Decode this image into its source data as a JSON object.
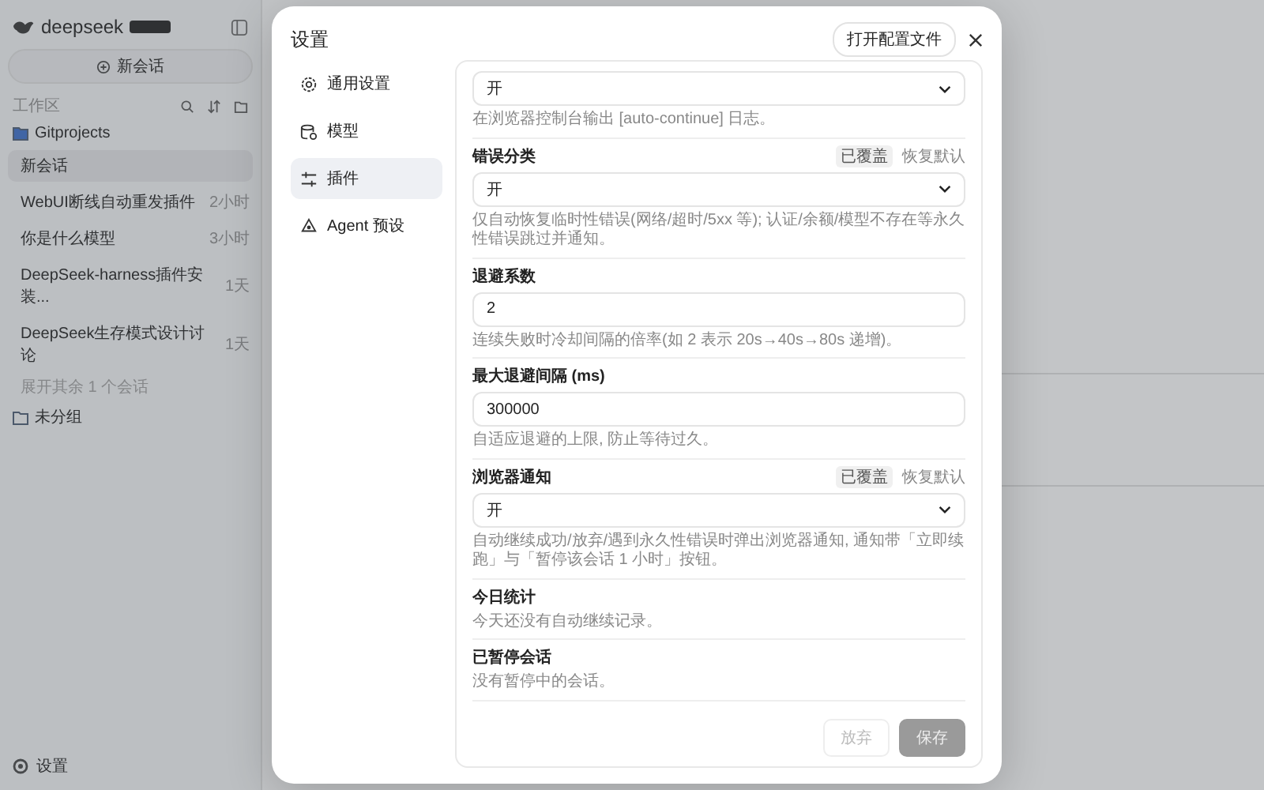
{
  "sidebar": {
    "logo": "deepseek",
    "new_chat": "新会话",
    "section_title": "工作区",
    "folders": [
      {
        "name": "Gitprojects",
        "expanded": true,
        "more": "展开其余 1 个会话",
        "children": [
          {
            "title": "新会话",
            "selected": true
          },
          {
            "title": "WebUI断线自动重发插件",
            "time": "2小时",
            "selected": false
          },
          {
            "title": "你是什么模型",
            "time": "3小时",
            "selected": false
          },
          {
            "title": "DeepSeek-harness插件安装...",
            "time": "1天",
            "selected": false
          },
          {
            "title": "DeepSeek生存模式设计讨论",
            "time": "1天",
            "selected": false
          }
        ]
      },
      {
        "name": "未分组",
        "expanded": false
      }
    ],
    "settings": "设置"
  },
  "dialog": {
    "title": "设置",
    "open_config": "打开配置文件",
    "nav": [
      {
        "label": "通用设置",
        "selected": false
      },
      {
        "label": "模型",
        "selected": false
      },
      {
        "label": "插件",
        "selected": true
      },
      {
        "label": "Agent 预设",
        "selected": false
      }
    ],
    "fields": [
      {
        "kind": "select",
        "overridden": false,
        "value": "开",
        "hint": "在浏览器控制台输出 [auto-continue] 日志。"
      },
      {
        "kind": "select",
        "label": "错误分类",
        "overridden": true,
        "badge": "已覆盖",
        "reset": "恢复默认",
        "value": "开",
        "hint": "仅自动恢复临时性错误(网络/超时/5xx 等); 认证/余额/模型不存在等永久性错误跳过并通知。"
      },
      {
        "kind": "input",
        "label": "退避系数",
        "overridden": false,
        "value": "2",
        "hint": "连续失败时冷却间隔的倍率(如 2 表示 20s→40s→80s 递增)。"
      },
      {
        "kind": "input",
        "label": "最大退避间隔 (ms)",
        "overridden": false,
        "value": "300000",
        "hint": "自适应退避的上限, 防止等待过久。"
      },
      {
        "kind": "select",
        "label": "浏览器通知",
        "overridden": true,
        "badge": "已覆盖",
        "reset": "恢复默认",
        "value": "开",
        "hint": "自动继续成功/放弃/遇到永久性错误时弹出浏览器通知, 通知带「立即续跑」与「暂停该会话 1 小时」按钮。"
      },
      {
        "kind": "info",
        "label": "今日统计",
        "overridden": false,
        "hint": "今天还没有自动继续记录。"
      },
      {
        "kind": "info",
        "label": "已暂停会话",
        "overridden": false,
        "hint": "没有暂停中的会话。"
      }
    ],
    "buttons": [
      {
        "label": "放弃",
        "kind": "secondary",
        "disabled": true
      },
      {
        "label": "保存",
        "kind": "primary",
        "disabled": true
      }
    ]
  }
}
